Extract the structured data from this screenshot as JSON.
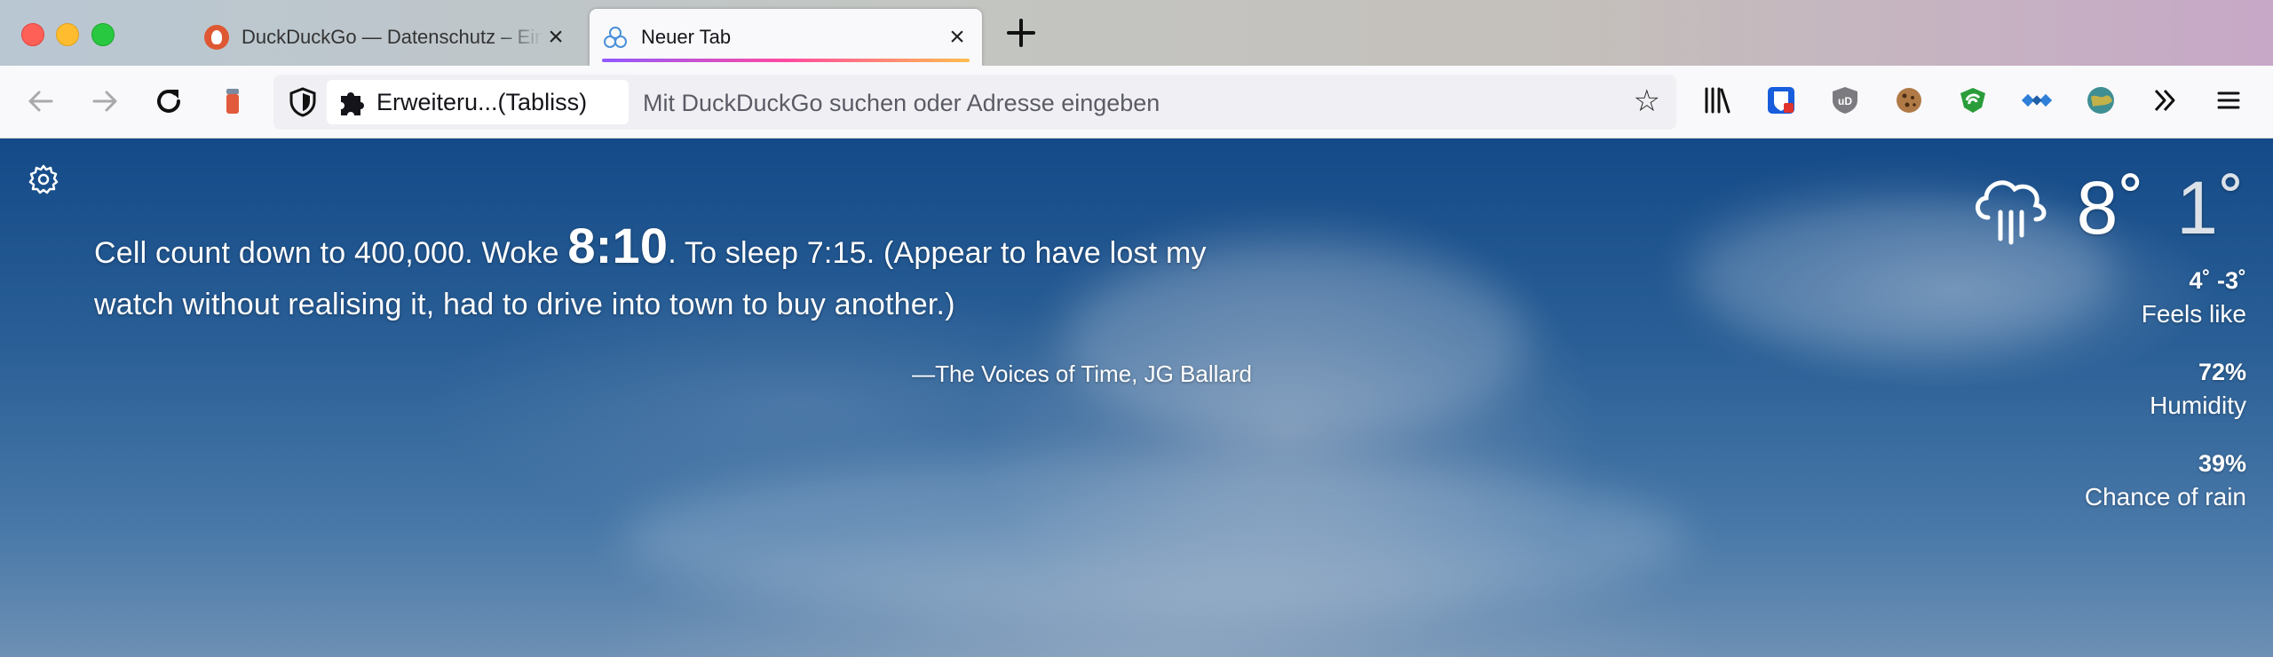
{
  "tabs": [
    {
      "title": "DuckDuckGo — Datenschutz – Einfach gemacht",
      "active": false
    },
    {
      "title": "Neuer Tab",
      "active": true
    }
  ],
  "toolbar": {
    "extension_chip_label": "Erweiteru...(Tabliss)",
    "url_placeholder": "Mit DuckDuckGo suchen oder Adresse eingeben"
  },
  "icons": {
    "back": "back-arrow-icon",
    "forward": "forward-arrow-icon",
    "reload": "reload-icon",
    "close": "close-icon",
    "new_tab": "plus-icon",
    "star": "bookmark-star-icon",
    "library": "library-icon",
    "overflow": "chevron-double-right-icon",
    "menu": "hamburger-menu-icon"
  },
  "quote": {
    "before": "Cell count down to 400,000. Woke ",
    "time": "8:10",
    "after": ". To sleep 7:15. (Appear to have lost my watch without realising it, had to drive into town to buy another.)",
    "author": "—The Voices of Time, JG Ballard"
  },
  "weather": {
    "high": "8˚",
    "low": "1˚",
    "feels_like_value": "4˚ -3˚",
    "feels_like_label": "Feels like",
    "humidity_value": "72%",
    "humidity_label": "Humidity",
    "rain_value": "39%",
    "rain_label": "Chance of rain"
  },
  "colors": {
    "tab_accent_start": "#9059ff",
    "tab_accent_mid": "#ff4aa2",
    "tab_accent_end": "#ffbd4f",
    "ddg_orange": "#de5833"
  }
}
